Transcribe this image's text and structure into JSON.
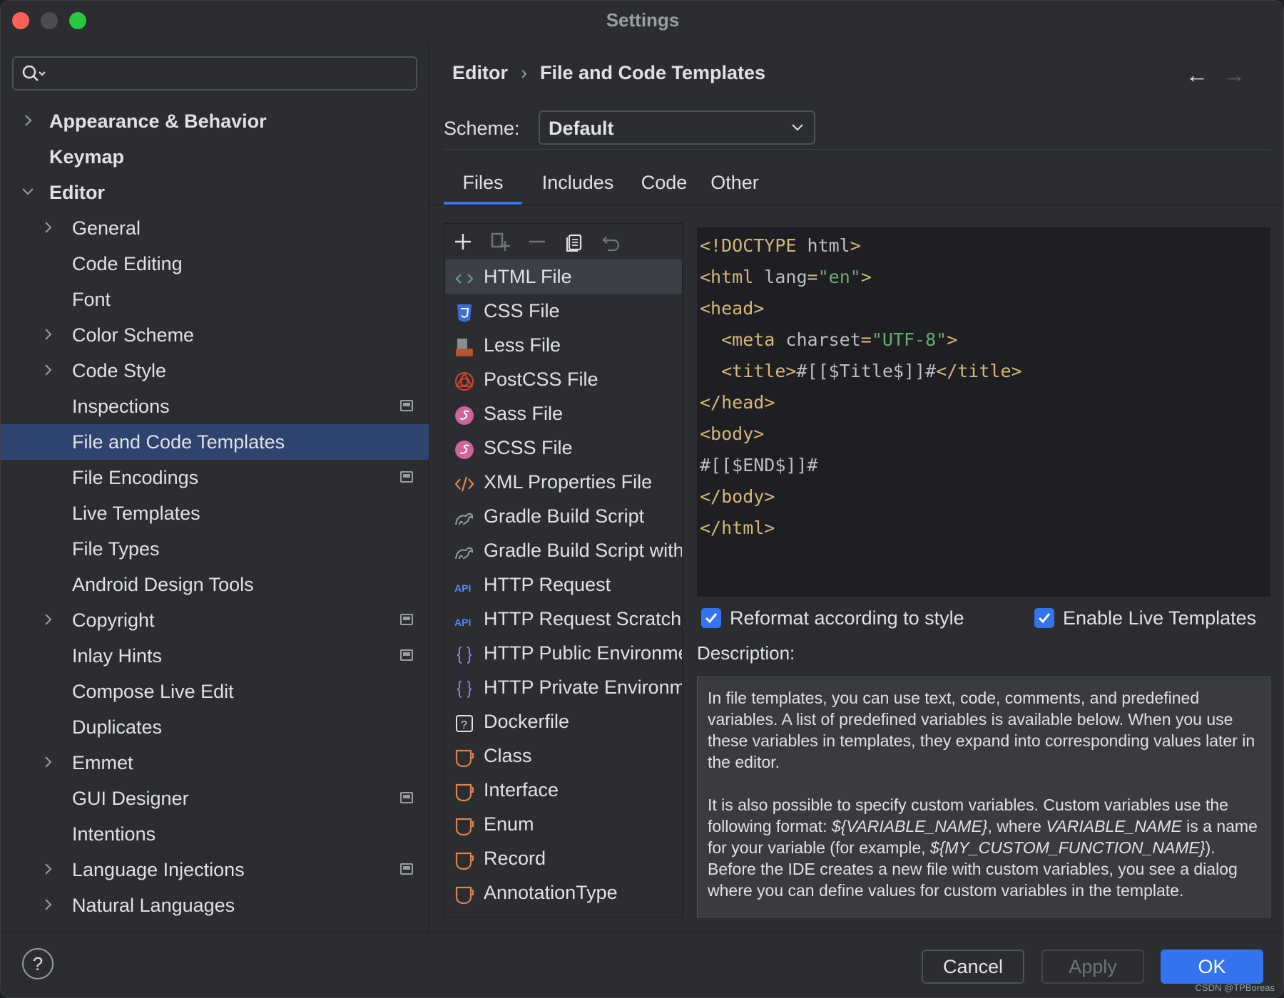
{
  "window": {
    "title": "Settings"
  },
  "search": {
    "placeholder": ""
  },
  "sidebar": {
    "items": [
      {
        "label": "Appearance & Behavior",
        "indent": 0,
        "chevron": "right",
        "bold": true
      },
      {
        "label": "Keymap",
        "indent": 0,
        "chevron": "none",
        "bold": true
      },
      {
        "label": "Editor",
        "indent": 0,
        "chevron": "down",
        "bold": true
      },
      {
        "label": "General",
        "indent": 1,
        "chevron": "right"
      },
      {
        "label": "Code Editing",
        "indent": 1,
        "chevron": "none"
      },
      {
        "label": "Font",
        "indent": 1,
        "chevron": "none"
      },
      {
        "label": "Color Scheme",
        "indent": 1,
        "chevron": "right"
      },
      {
        "label": "Code Style",
        "indent": 1,
        "chevron": "right"
      },
      {
        "label": "Inspections",
        "indent": 1,
        "chevron": "none",
        "pin": true
      },
      {
        "label": "File and Code Templates",
        "indent": 1,
        "chevron": "none",
        "selected": true
      },
      {
        "label": "File Encodings",
        "indent": 1,
        "chevron": "none",
        "pin": true
      },
      {
        "label": "Live Templates",
        "indent": 1,
        "chevron": "none"
      },
      {
        "label": "File Types",
        "indent": 1,
        "chevron": "none"
      },
      {
        "label": "Android Design Tools",
        "indent": 1,
        "chevron": "none"
      },
      {
        "label": "Copyright",
        "indent": 1,
        "chevron": "right",
        "pin": true
      },
      {
        "label": "Inlay Hints",
        "indent": 1,
        "chevron": "none",
        "pin": true
      },
      {
        "label": "Compose Live Edit",
        "indent": 1,
        "chevron": "none"
      },
      {
        "label": "Duplicates",
        "indent": 1,
        "chevron": "none"
      },
      {
        "label": "Emmet",
        "indent": 1,
        "chevron": "right"
      },
      {
        "label": "GUI Designer",
        "indent": 1,
        "chevron": "none",
        "pin": true
      },
      {
        "label": "Intentions",
        "indent": 1,
        "chevron": "none"
      },
      {
        "label": "Language Injections",
        "indent": 1,
        "chevron": "right",
        "pin": true
      },
      {
        "label": "Natural Languages",
        "indent": 1,
        "chevron": "right"
      }
    ]
  },
  "breadcrumb": {
    "parent": "Editor",
    "current": "File and Code Templates",
    "separator": "›"
  },
  "nav": {
    "back": "←",
    "forward": "→"
  },
  "scheme": {
    "label": "Scheme:",
    "value": "Default"
  },
  "tabs": [
    {
      "label": "Files",
      "active": true
    },
    {
      "label": "Includes"
    },
    {
      "label": "Code"
    },
    {
      "label": "Other"
    }
  ],
  "toolbar_icons": [
    "plus-icon",
    "add-child-icon",
    "minus-icon",
    "copy-icon",
    "undo-icon"
  ],
  "templates": [
    {
      "name": "HTML File",
      "icon": "html-icon",
      "selected": true
    },
    {
      "name": "CSS File",
      "icon": "css-icon"
    },
    {
      "name": "Less File",
      "icon": "less-icon"
    },
    {
      "name": "PostCSS File",
      "icon": "postcss-icon"
    },
    {
      "name": "Sass File",
      "icon": "sass-icon"
    },
    {
      "name": "SCSS File",
      "icon": "scss-icon"
    },
    {
      "name": "XML Properties File",
      "icon": "xml-icon"
    },
    {
      "name": "Gradle Build Script",
      "icon": "gradle-icon"
    },
    {
      "name": "Gradle Build Script with",
      "icon": "gradle-icon"
    },
    {
      "name": "HTTP Request",
      "icon": "api-icon"
    },
    {
      "name": "HTTP Request Scratch",
      "icon": "api-icon"
    },
    {
      "name": "HTTP Public Environment",
      "icon": "braces-icon"
    },
    {
      "name": "HTTP Private Environment",
      "icon": "braces-icon"
    },
    {
      "name": "Dockerfile",
      "icon": "unknown-file-icon"
    },
    {
      "name": "Class",
      "icon": "java-icon"
    },
    {
      "name": "Interface",
      "icon": "java-icon"
    },
    {
      "name": "Enum",
      "icon": "java-icon"
    },
    {
      "name": "Record",
      "icon": "java-icon"
    },
    {
      "name": "AnnotationType",
      "icon": "java-icon"
    }
  ],
  "code": {
    "lines": [
      [
        {
          "t": "<!DOCTYPE ",
          "c": "kw"
        },
        {
          "t": "html",
          "c": "tx"
        },
        {
          "t": ">",
          "c": "kw"
        }
      ],
      [
        {
          "t": "<html ",
          "c": "kw"
        },
        {
          "t": "lang",
          "c": "tx"
        },
        {
          "t": "=",
          "c": "kw"
        },
        {
          "t": "\"en\"",
          "c": "st"
        },
        {
          "t": ">",
          "c": "kw"
        }
      ],
      [
        {
          "t": "<head>",
          "c": "kw"
        }
      ],
      [
        {
          "t": "  <meta ",
          "c": "kw"
        },
        {
          "t": "charset",
          "c": "tx"
        },
        {
          "t": "=",
          "c": "kw"
        },
        {
          "t": "\"UTF-8\"",
          "c": "st"
        },
        {
          "t": ">",
          "c": "kw"
        }
      ],
      [
        {
          "t": "  <title>",
          "c": "kw"
        },
        {
          "t": "#[[$Title$]]#",
          "c": "tx"
        },
        {
          "t": "</title>",
          "c": "kw"
        }
      ],
      [
        {
          "t": "</head>",
          "c": "kw"
        }
      ],
      [
        {
          "t": "<body>",
          "c": "kw"
        }
      ],
      [
        {
          "t": "#[[$END$]]#",
          "c": "tx"
        }
      ],
      [
        {
          "t": "</body>",
          "c": "kw"
        }
      ],
      [
        {
          "t": "</html>",
          "c": "kw"
        }
      ]
    ]
  },
  "options": {
    "reformat": {
      "label": "Reformat according to style",
      "checked": true
    },
    "live_templates": {
      "label": "Enable Live Templates",
      "checked": true
    }
  },
  "description": {
    "label": "Description:",
    "p1": "In file templates, you can use text, code, comments, and predefined variables. A list of predefined variables is available below. When you use these variables in templates, they expand into corresponding values later in the editor.",
    "p2a": "It is also possible to specify custom variables. Custom variables use the following format: ",
    "p2var1": "${VARIABLE_NAME}",
    "p2b": ", where ",
    "p2var2": "VARIABLE_NAME",
    "p2c": " is a name for your variable (for example, ",
    "p2var3": "${MY_CUSTOM_FUNCTION_NAME}",
    "p2d": "). Before the IDE creates a new file with custom variables, you see a dialog where you can define values for custom variables in the template."
  },
  "footer": {
    "help": "?",
    "cancel": "Cancel",
    "apply": "Apply",
    "ok": "OK",
    "watermark": "CSDN @TPBoreas"
  },
  "colors": {
    "accent": "#3574f0",
    "selection": "#2e436e",
    "background": "#2b2d30",
    "editor_bg": "#1e1f22"
  }
}
